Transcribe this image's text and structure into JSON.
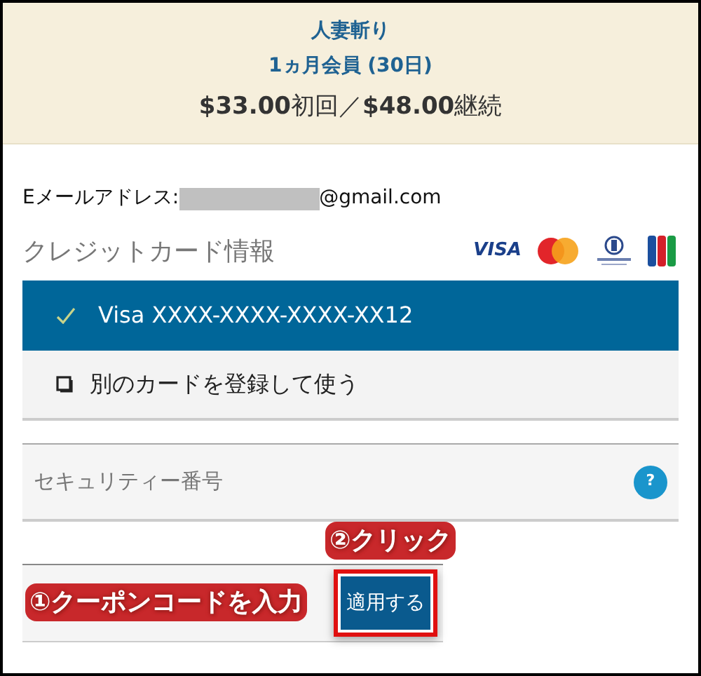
{
  "plan": {
    "title": "人妻斬り",
    "term": "1ヵ月会員 (30日)",
    "price_first": "$33.00",
    "price_first_label": "初回",
    "separator": "／",
    "price_renew": "$48.00",
    "price_renew_label": "継続"
  },
  "email": {
    "label": "Eメールアドレス:",
    "domain": "@gmail.com"
  },
  "credit_card": {
    "heading": "クレジットカード情報",
    "visa_logo": "VISA",
    "options": [
      {
        "kind": "saved",
        "label": "Visa XXXX-XXXX-XXXX-XX12",
        "selected": true
      },
      {
        "kind": "new",
        "label": "別のカードを登録して使う",
        "selected": false
      }
    ]
  },
  "security_field": {
    "placeholder": "セキュリティー番号",
    "help": "?"
  },
  "coupon": {
    "apply_button": "適用する"
  },
  "annotations": [
    {
      "label": "②クリック"
    },
    {
      "label": "①クーポンコードを入力"
    }
  ]
}
